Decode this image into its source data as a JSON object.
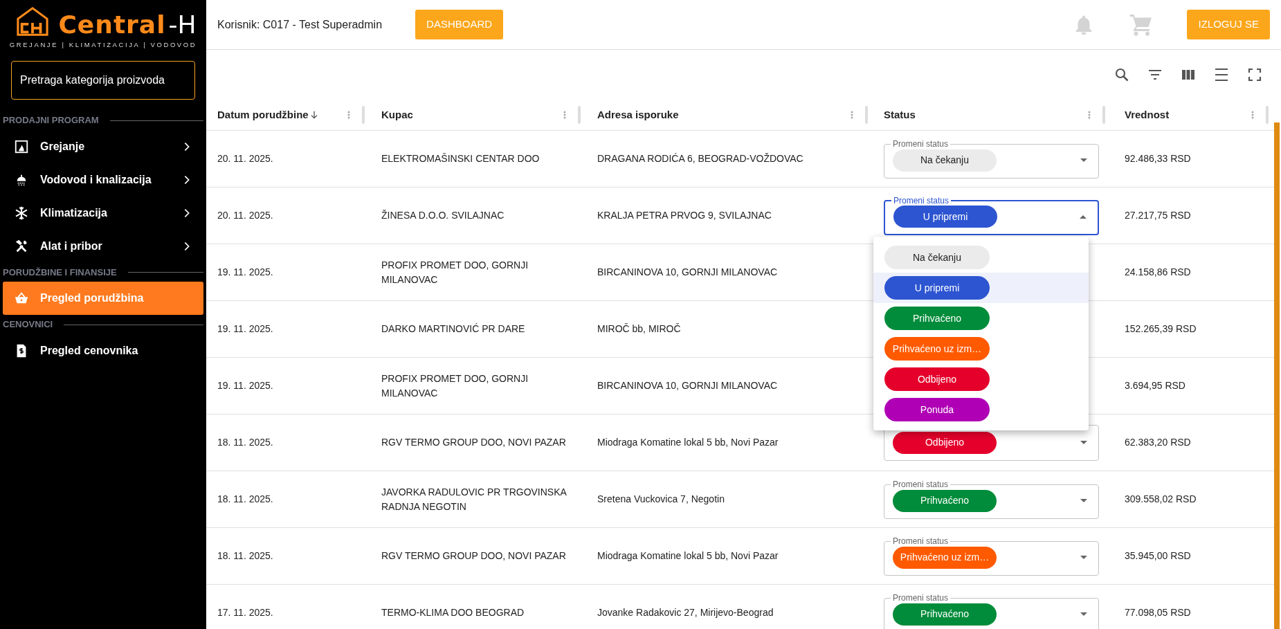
{
  "logo": {
    "name": "Central",
    "suffix": "-H",
    "tagline": "GREJANJE | KLIMATIZACIJA | VODOVOD"
  },
  "sidebar": {
    "search": {
      "placeholder": "Pretraga kategorija proizvoda"
    },
    "sections": [
      {
        "title": "PRODAJNI PROGRAM",
        "items": [
          {
            "label": "Grejanje",
            "kind": "fireplace",
            "has_submenu": true,
            "selected": false
          },
          {
            "label": "Vodovod i knalizacija",
            "kind": "shower",
            "has_submenu": true,
            "selected": false
          },
          {
            "label": "Klimatizacija",
            "kind": "snowflake",
            "has_submenu": true,
            "selected": false
          },
          {
            "label": "Alat i pribor",
            "kind": "tools",
            "has_submenu": true,
            "selected": false
          }
        ]
      },
      {
        "title": "PORUDŽBINE I FINANSIJE",
        "items": [
          {
            "label": "Pregled porudžbina",
            "kind": "basket",
            "has_submenu": false,
            "selected": true
          }
        ]
      },
      {
        "title": "CENOVNICI",
        "items": [
          {
            "label": "Pregled cenovnika",
            "kind": "invoice",
            "has_submenu": false,
            "selected": false
          }
        ]
      }
    ]
  },
  "header": {
    "user": "Korisnik: C017 - Test Superadmin",
    "dashboard_button": "DASHBOARD",
    "logout_button": "IZLOGUJ SE"
  },
  "table": {
    "columns": [
      {
        "label": "Datum porudžbine",
        "sorted": true
      },
      {
        "label": "Kupac",
        "sorted": false
      },
      {
        "label": "Adresa isporuke",
        "sorted": false
      },
      {
        "label": "Status",
        "sorted": false
      },
      {
        "label": "Vrednost",
        "sorted": false
      }
    ],
    "rows": [
      {
        "date": "20. 11. 2025.",
        "customer": "ELEKTROMAŠINSKI CENTAR DOO",
        "address": "DRAGANA RODIĆA 6, BEOGRAD-VOŽDOVAC",
        "status": {
          "label": "Promeni status",
          "value": "Na čekanju",
          "color": "#ebebeb",
          "expanded": false
        },
        "value": "92.486,33 RSD"
      },
      {
        "date": "20. 11. 2025.",
        "customer": "ŽINESA D.O.O. SVILAJNAC",
        "address": "KRALJA PETRA PRVOG 9, SVILAJNAC",
        "status": {
          "label": "Promeni status",
          "value": "U pripremi",
          "color": "#2d55d1",
          "expanded": true
        },
        "value": "27.217,75 RSD"
      },
      {
        "date": "19. 11. 2025.",
        "customer": "PROFIX PROMET DOO, GORNJI MILANOVAC",
        "address": "BIRCANINOVA 10, GORNJI MILANOVAC",
        "value": "24.158,86 RSD"
      },
      {
        "date": "19. 11. 2025.",
        "customer": "DARKO MARTINOVIĆ PR DARE",
        "address": "MIROČ bb, MIROČ",
        "value": "152.265,39 RSD"
      },
      {
        "date": "19. 11. 2025.",
        "customer": "PROFIX PROMET DOO, GORNJI MILANOVAC",
        "address": "BIRCANINOVA 10, GORNJI MILANOVAC",
        "value": "3.694,95 RSD"
      },
      {
        "date": "18. 11. 2025.",
        "customer": "RGV TERMO GROUP DOO, NOVI PAZAR",
        "address": "Miodraga Komatine lokal 5 bb, Novi Pazar",
        "status": {
          "value": "Odbijeno",
          "color": "#e4002b",
          "expanded": false
        },
        "value": "62.383,20 RSD"
      },
      {
        "date": "18. 11. 2025.",
        "customer": "JAVORKA RADULOVIC PR TRGOVINSKA RADNJA NEGOTIN",
        "address": "Sretena Vuckovica 7, Negotin",
        "status": {
          "label": "Promeni status",
          "value": "Prihvaćeno",
          "color": "#008c3a",
          "expanded": false
        },
        "value": "309.558,02 RSD"
      },
      {
        "date": "18. 11. 2025.",
        "customer": "RGV TERMO GROUP DOO, NOVI PAZAR",
        "address": "Miodraga Komatine lokal 5 bb, Novi Pazar",
        "status": {
          "label": "Promeni status",
          "value": "Prihvaćeno uz izm…",
          "color": "#ff5a00",
          "expanded": false
        },
        "value": "35.945,00 RSD"
      },
      {
        "date": "17. 11. 2025.",
        "customer": "TERMO-KLIMA DOO BEOGRAD",
        "address": "Jovanke Radakovic 27, Mirijevo-Beograd",
        "status": {
          "label": "Promeni status",
          "value": "Prihvaćeno",
          "color": "#008c3a",
          "expanded": false
        },
        "value": "77.098,05 RSD"
      }
    ],
    "status_menu": [
      {
        "label": "Na čekanju",
        "color": "#ebebeb",
        "selected": false
      },
      {
        "label": "U pripremi",
        "color": "#2d55d1",
        "selected": true
      },
      {
        "label": "Prihvaćeno",
        "color": "#008c3a",
        "selected": false
      },
      {
        "label": "Prihvaćeno uz izm…",
        "color": "#ff5a00",
        "selected": false
      },
      {
        "label": "Odbijeno",
        "color": "#e4002b",
        "selected": false
      },
      {
        "label": "Ponuda",
        "color": "#b000b5",
        "selected": false
      }
    ]
  }
}
